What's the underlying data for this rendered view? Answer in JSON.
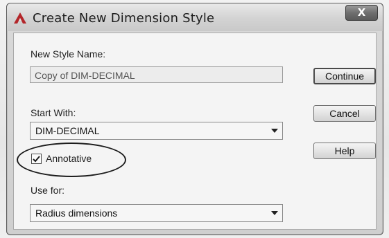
{
  "dialog": {
    "title": "Create New Dimension Style",
    "close_glyph": "X",
    "app_icon": "autocad-a-icon"
  },
  "form": {
    "new_style_name_label": "New Style Name:",
    "new_style_name_value": "Copy of DIM-DECIMAL",
    "start_with_label": "Start With:",
    "start_with_value": "DIM-DECIMAL",
    "annotative_label": "Annotative",
    "annotative_checked": true,
    "use_for_label": "Use for:",
    "use_for_value": "Radius dimensions"
  },
  "buttons": {
    "continue": "Continue",
    "cancel": "Cancel",
    "help": "Help"
  }
}
